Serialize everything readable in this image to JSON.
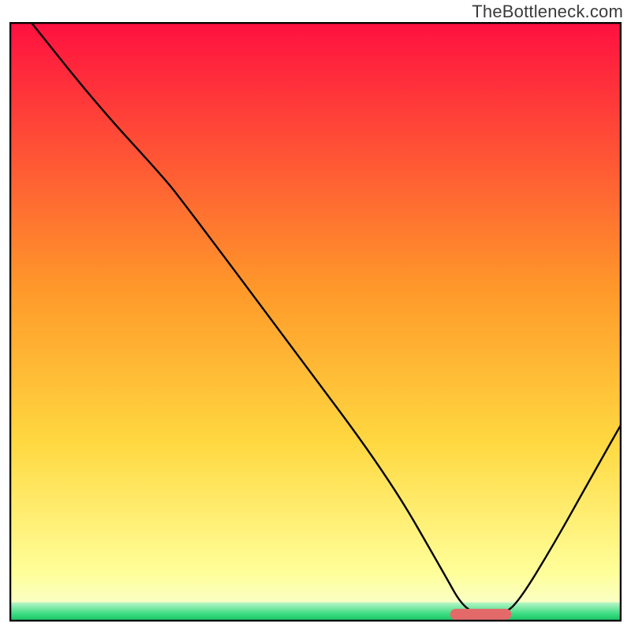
{
  "watermark": "TheBottleneck.com",
  "chart_data": {
    "type": "line",
    "title": "",
    "xlabel": "",
    "ylabel": "",
    "xlim": [
      0,
      100
    ],
    "ylim": [
      0,
      100
    ],
    "background_gradient": {
      "top": "#ff1040",
      "mid": "#ffd840",
      "bottom_yellow": "#ffff9a",
      "green": "#2ecc71"
    },
    "green_band_y": [
      0,
      3.2
    ],
    "marker": {
      "shape": "rounded-rect",
      "x_range": [
        72,
        82
      ],
      "y": 1.2,
      "color": "#e46a6a"
    },
    "series": [
      {
        "name": "curve",
        "color": "#000000",
        "points": [
          {
            "x": 3.5,
            "y": 100.0
          },
          {
            "x": 14.5,
            "y": 86.0
          },
          {
            "x": 24.8,
            "y": 74.5
          },
          {
            "x": 28.0,
            "y": 70.5
          },
          {
            "x": 46.0,
            "y": 46.0
          },
          {
            "x": 62.0,
            "y": 24.0
          },
          {
            "x": 71.0,
            "y": 8.0
          },
          {
            "x": 74.0,
            "y": 2.5
          },
          {
            "x": 77.0,
            "y": 1.0
          },
          {
            "x": 80.5,
            "y": 1.2
          },
          {
            "x": 83.0,
            "y": 3.0
          },
          {
            "x": 89.0,
            "y": 13.0
          },
          {
            "x": 95.0,
            "y": 24.0
          },
          {
            "x": 100.0,
            "y": 33.0
          }
        ]
      }
    ]
  }
}
